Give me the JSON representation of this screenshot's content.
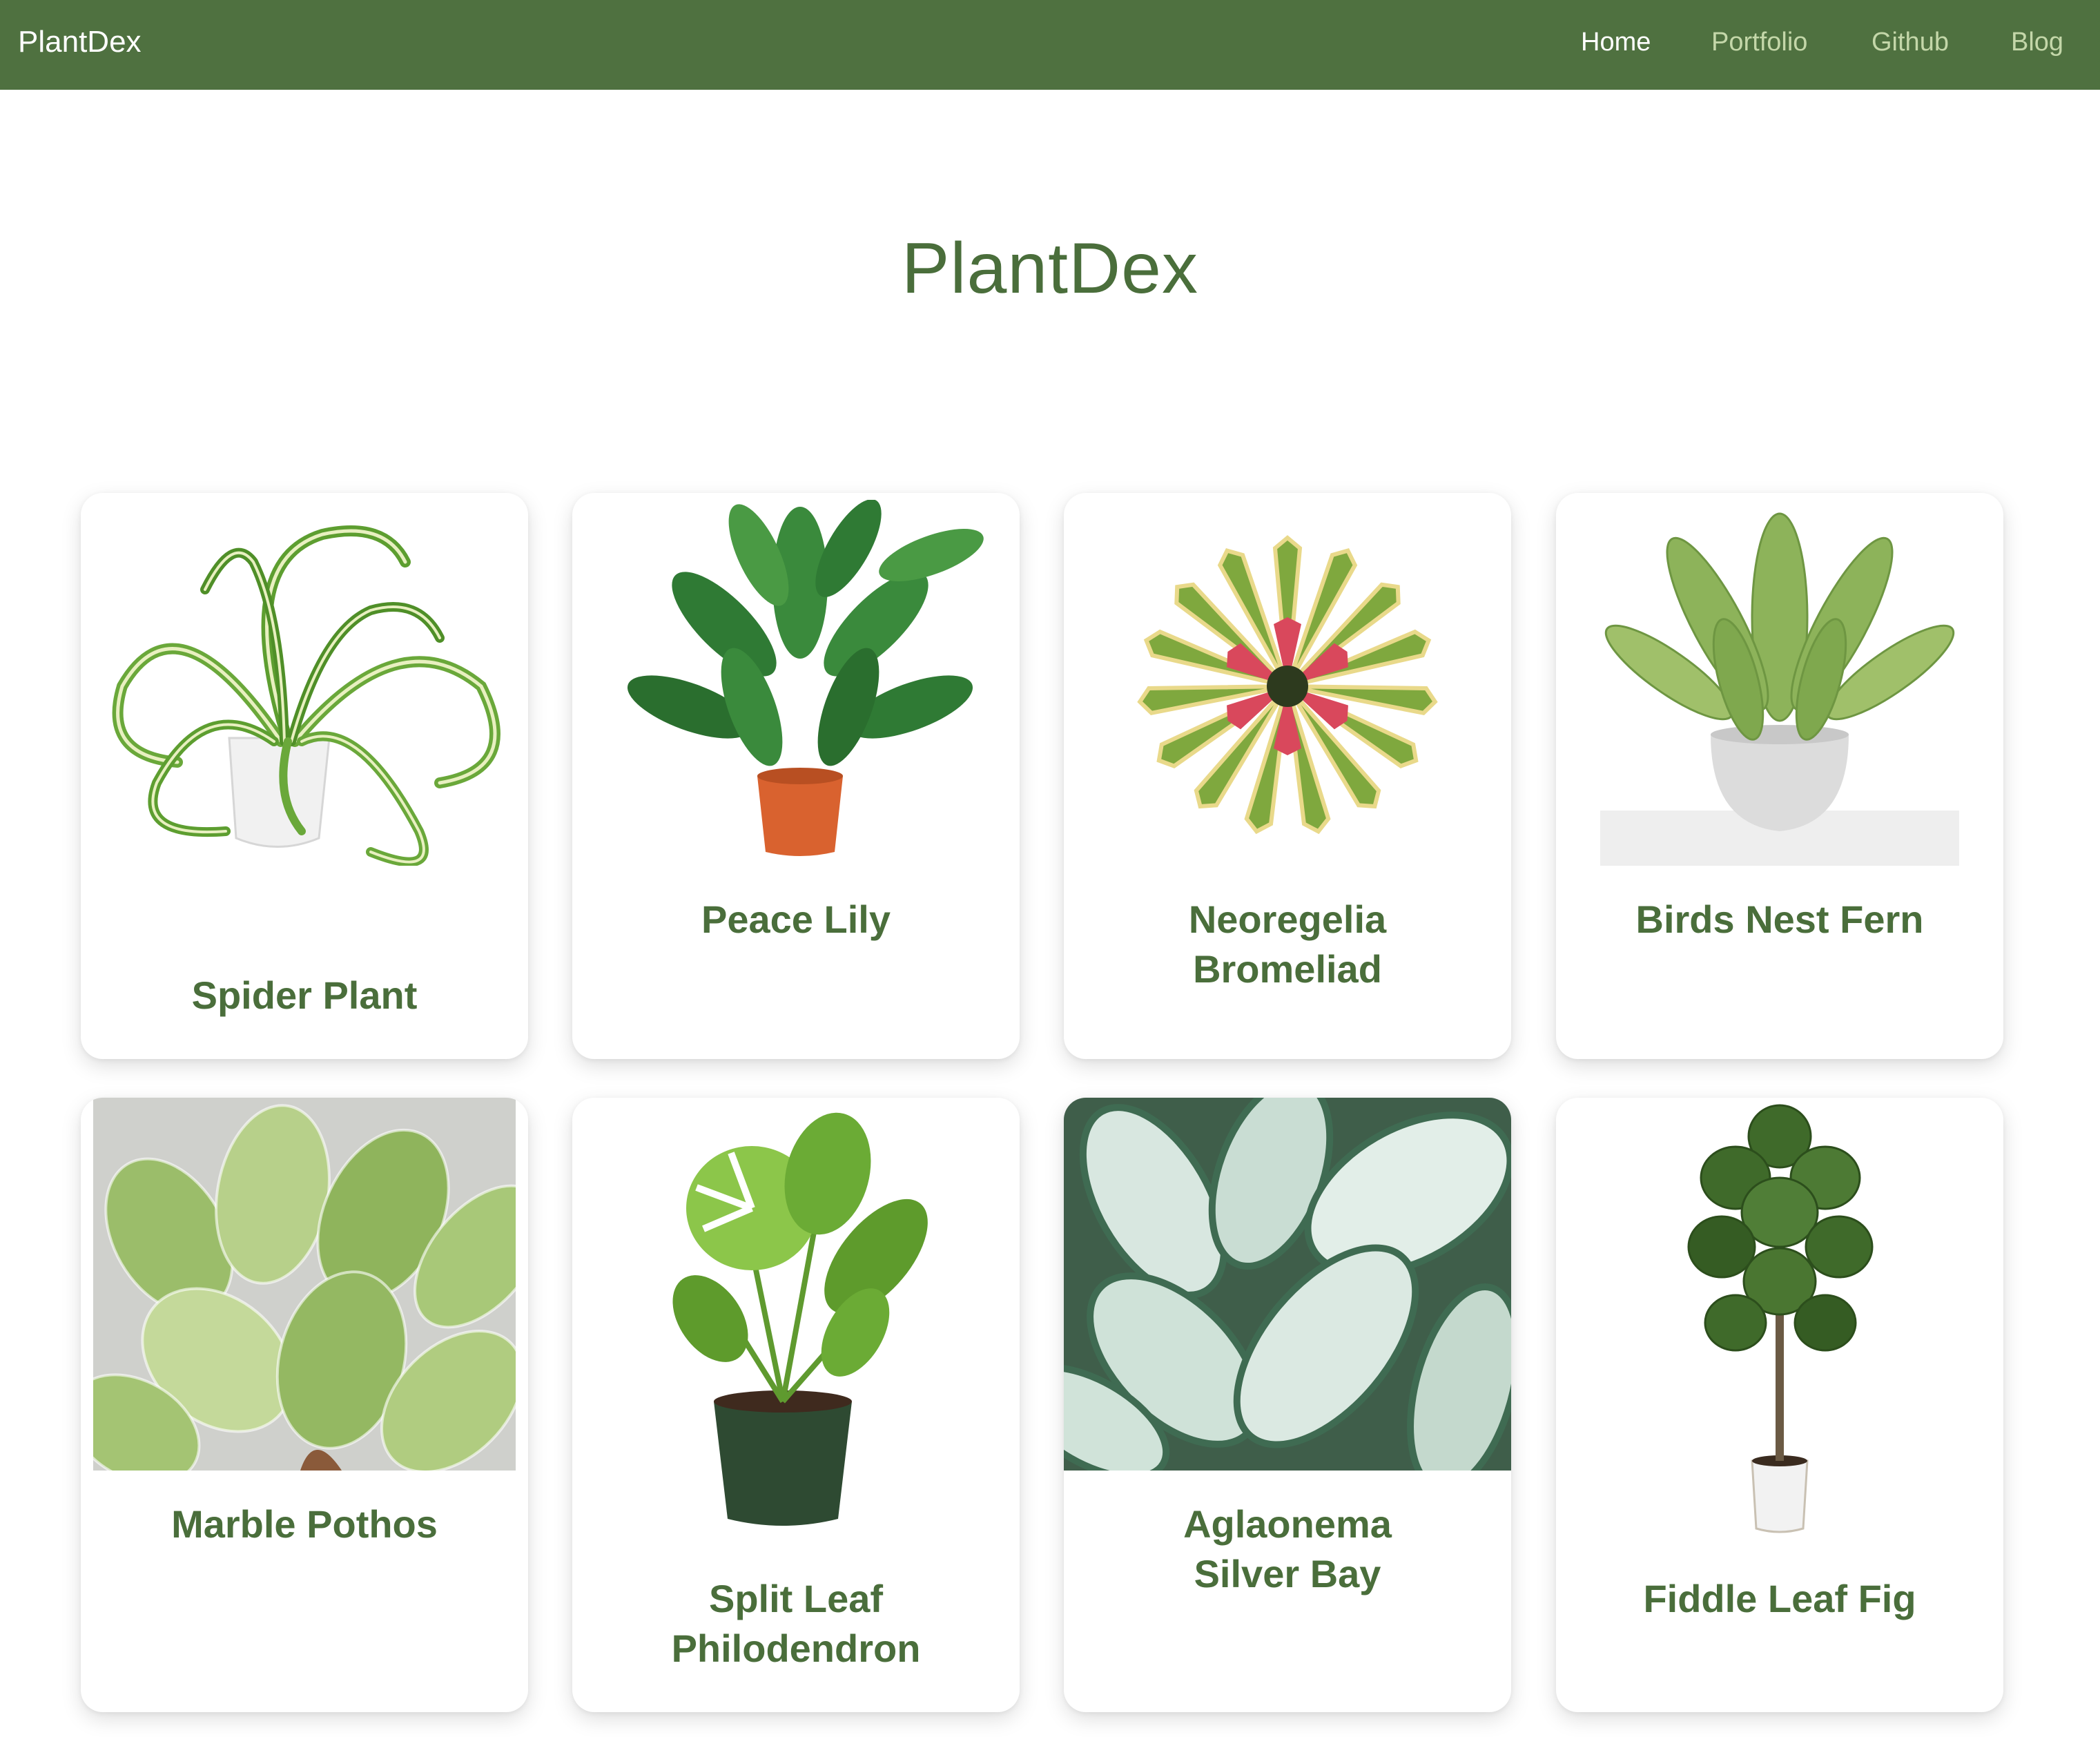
{
  "navbar": {
    "brand": "PlantDex",
    "links": [
      {
        "label": "Home",
        "active": true
      },
      {
        "label": "Portfolio",
        "active": false
      },
      {
        "label": "Github",
        "active": false
      },
      {
        "label": "Blog",
        "active": false
      }
    ]
  },
  "page": {
    "title": "PlantDex"
  },
  "plants": [
    {
      "lines": [
        "Spider Plant"
      ],
      "image": "spider-plant-image"
    },
    {
      "lines": [
        "Peace Lily"
      ],
      "image": "peace-lily-image"
    },
    {
      "lines": [
        "Neoregelia",
        "Bromeliad"
      ],
      "image": "bromeliad-image"
    },
    {
      "lines": [
        "Birds Nest Fern"
      ],
      "image": "birds-nest-fern-image"
    },
    {
      "lines": [
        "Marble Pothos"
      ],
      "image": "marble-pothos-image"
    },
    {
      "lines": [
        "Split Leaf",
        "Philodendron"
      ],
      "image": "split-leaf-philodendron-image"
    },
    {
      "lines": [
        "Aglaonema",
        "Silver Bay"
      ],
      "image": "aglaonema-image"
    },
    {
      "lines": [
        "Fiddle Leaf Fig"
      ],
      "image": "fiddle-leaf-fig-image"
    }
  ],
  "colors": {
    "navbar": "#4f7140",
    "accent_text": "#4a6e3b",
    "nav_inactive": "#c4d7a9"
  }
}
